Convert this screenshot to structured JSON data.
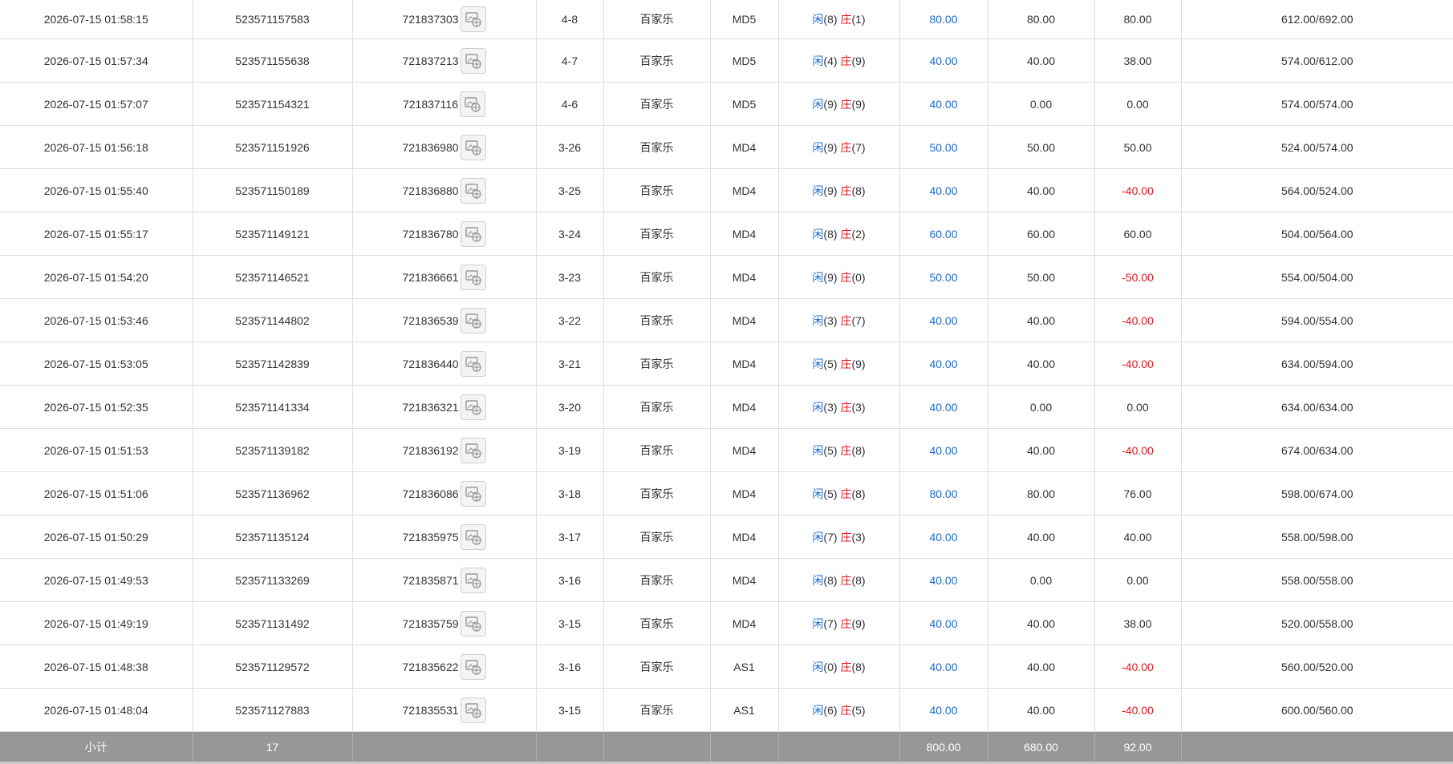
{
  "table": {
    "rows": [
      {
        "time": "2026-07-15 01:58:15",
        "bet_id": "523571157583",
        "round_id": "721837303",
        "shoe": "4-8",
        "game": "百家乐",
        "table": "MD5",
        "player_label": "闲",
        "player_score": "(8)",
        "banker_label": "庄",
        "banker_score": "(1)",
        "bet": "80.00",
        "valid": "80.00",
        "win": "80.00",
        "win_neg": false,
        "balance": "612.00/692.00"
      },
      {
        "time": "2026-07-15 01:57:34",
        "bet_id": "523571155638",
        "round_id": "721837213",
        "shoe": "4-7",
        "game": "百家乐",
        "table": "MD5",
        "player_label": "闲",
        "player_score": "(4)",
        "banker_label": "庄",
        "banker_score": "(9)",
        "bet": "40.00",
        "valid": "40.00",
        "win": "38.00",
        "win_neg": false,
        "balance": "574.00/612.00"
      },
      {
        "time": "2026-07-15 01:57:07",
        "bet_id": "523571154321",
        "round_id": "721837116",
        "shoe": "4-6",
        "game": "百家乐",
        "table": "MD5",
        "player_label": "闲",
        "player_score": "(9)",
        "banker_label": "庄",
        "banker_score": "(9)",
        "bet": "40.00",
        "valid": "0.00",
        "win": "0.00",
        "win_neg": false,
        "balance": "574.00/574.00"
      },
      {
        "time": "2026-07-15 01:56:18",
        "bet_id": "523571151926",
        "round_id": "721836980",
        "shoe": "3-26",
        "game": "百家乐",
        "table": "MD4",
        "player_label": "闲",
        "player_score": "(9)",
        "banker_label": "庄",
        "banker_score": "(7)",
        "bet": "50.00",
        "valid": "50.00",
        "win": "50.00",
        "win_neg": false,
        "balance": "524.00/574.00"
      },
      {
        "time": "2026-07-15 01:55:40",
        "bet_id": "523571150189",
        "round_id": "721836880",
        "shoe": "3-25",
        "game": "百家乐",
        "table": "MD4",
        "player_label": "闲",
        "player_score": "(9)",
        "banker_label": "庄",
        "banker_score": "(8)",
        "bet": "40.00",
        "valid": "40.00",
        "win": "-40.00",
        "win_neg": true,
        "balance": "564.00/524.00"
      },
      {
        "time": "2026-07-15 01:55:17",
        "bet_id": "523571149121",
        "round_id": "721836780",
        "shoe": "3-24",
        "game": "百家乐",
        "table": "MD4",
        "player_label": "闲",
        "player_score": "(8)",
        "banker_label": "庄",
        "banker_score": "(2)",
        "bet": "60.00",
        "valid": "60.00",
        "win": "60.00",
        "win_neg": false,
        "balance": "504.00/564.00"
      },
      {
        "time": "2026-07-15 01:54:20",
        "bet_id": "523571146521",
        "round_id": "721836661",
        "shoe": "3-23",
        "game": "百家乐",
        "table": "MD4",
        "player_label": "闲",
        "player_score": "(9)",
        "banker_label": "庄",
        "banker_score": "(0)",
        "bet": "50.00",
        "valid": "50.00",
        "win": "-50.00",
        "win_neg": true,
        "balance": "554.00/504.00"
      },
      {
        "time": "2026-07-15 01:53:46",
        "bet_id": "523571144802",
        "round_id": "721836539",
        "shoe": "3-22",
        "game": "百家乐",
        "table": "MD4",
        "player_label": "闲",
        "player_score": "(3)",
        "banker_label": "庄",
        "banker_score": "(7)",
        "bet": "40.00",
        "valid": "40.00",
        "win": "-40.00",
        "win_neg": true,
        "balance": "594.00/554.00"
      },
      {
        "time": "2026-07-15 01:53:05",
        "bet_id": "523571142839",
        "round_id": "721836440",
        "shoe": "3-21",
        "game": "百家乐",
        "table": "MD4",
        "player_label": "闲",
        "player_score": "(5)",
        "banker_label": "庄",
        "banker_score": "(9)",
        "bet": "40.00",
        "valid": "40.00",
        "win": "-40.00",
        "win_neg": true,
        "balance": "634.00/594.00"
      },
      {
        "time": "2026-07-15 01:52:35",
        "bet_id": "523571141334",
        "round_id": "721836321",
        "shoe": "3-20",
        "game": "百家乐",
        "table": "MD4",
        "player_label": "闲",
        "player_score": "(3)",
        "banker_label": "庄",
        "banker_score": "(3)",
        "bet": "40.00",
        "valid": "0.00",
        "win": "0.00",
        "win_neg": false,
        "balance": "634.00/634.00"
      },
      {
        "time": "2026-07-15 01:51:53",
        "bet_id": "523571139182",
        "round_id": "721836192",
        "shoe": "3-19",
        "game": "百家乐",
        "table": "MD4",
        "player_label": "闲",
        "player_score": "(5)",
        "banker_label": "庄",
        "banker_score": "(8)",
        "bet": "40.00",
        "valid": "40.00",
        "win": "-40.00",
        "win_neg": true,
        "balance": "674.00/634.00"
      },
      {
        "time": "2026-07-15 01:51:06",
        "bet_id": "523571136962",
        "round_id": "721836086",
        "shoe": "3-18",
        "game": "百家乐",
        "table": "MD4",
        "player_label": "闲",
        "player_score": "(5)",
        "banker_label": "庄",
        "banker_score": "(8)",
        "bet": "80.00",
        "valid": "80.00",
        "win": "76.00",
        "win_neg": false,
        "balance": "598.00/674.00"
      },
      {
        "time": "2026-07-15 01:50:29",
        "bet_id": "523571135124",
        "round_id": "721835975",
        "shoe": "3-17",
        "game": "百家乐",
        "table": "MD4",
        "player_label": "闲",
        "player_score": "(7)",
        "banker_label": "庄",
        "banker_score": "(3)",
        "bet": "40.00",
        "valid": "40.00",
        "win": "40.00",
        "win_neg": false,
        "balance": "558.00/598.00"
      },
      {
        "time": "2026-07-15 01:49:53",
        "bet_id": "523571133269",
        "round_id": "721835871",
        "shoe": "3-16",
        "game": "百家乐",
        "table": "MD4",
        "player_label": "闲",
        "player_score": "(8)",
        "banker_label": "庄",
        "banker_score": "(8)",
        "bet": "40.00",
        "valid": "0.00",
        "win": "0.00",
        "win_neg": false,
        "balance": "558.00/558.00"
      },
      {
        "time": "2026-07-15 01:49:19",
        "bet_id": "523571131492",
        "round_id": "721835759",
        "shoe": "3-15",
        "game": "百家乐",
        "table": "MD4",
        "player_label": "闲",
        "player_score": "(7)",
        "banker_label": "庄",
        "banker_score": "(9)",
        "bet": "40.00",
        "valid": "40.00",
        "win": "38.00",
        "win_neg": false,
        "balance": "520.00/558.00"
      },
      {
        "time": "2026-07-15 01:48:38",
        "bet_id": "523571129572",
        "round_id": "721835622",
        "shoe": "3-16",
        "game": "百家乐",
        "table": "AS1",
        "player_label": "闲",
        "player_score": "(0)",
        "banker_label": "庄",
        "banker_score": "(8)",
        "bet": "40.00",
        "valid": "40.00",
        "win": "-40.00",
        "win_neg": true,
        "balance": "560.00/520.00"
      },
      {
        "time": "2026-07-15 01:48:04",
        "bet_id": "523571127883",
        "round_id": "721835531",
        "shoe": "3-15",
        "game": "百家乐",
        "table": "AS1",
        "player_label": "闲",
        "player_score": "(6)",
        "banker_label": "庄",
        "banker_score": "(5)",
        "bet": "40.00",
        "valid": "40.00",
        "win": "-40.00",
        "win_neg": true,
        "balance": "600.00/560.00"
      }
    ],
    "summary": {
      "label": "小计",
      "count": "17",
      "bet_total": "800.00",
      "valid_total": "680.00",
      "win_total": "92.00"
    }
  },
  "icons": {
    "detail": "replay-detail-icon"
  },
  "colors": {
    "blue": "#1a6bd6",
    "red": "#e4181f",
    "summary_bg": "#979797",
    "border": "#dedede"
  }
}
